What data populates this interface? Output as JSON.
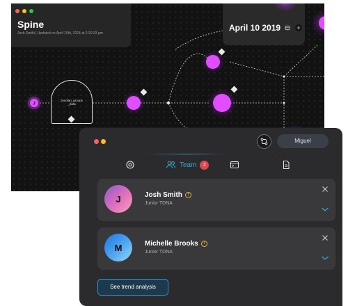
{
  "graph_window": {
    "title": "Spine",
    "subtitle": "Josh Smith | Updated on April 10th, 2024 at 2:20:33 pm",
    "date_label": "April 10 2019",
    "group_node_label": "zendian_groups\n_data"
  },
  "team_panel": {
    "user_name": "Miguel",
    "tabs": {
      "team_label": "Team",
      "team_count": "2"
    },
    "members": [
      {
        "initial": "J",
        "name": "Josh Smith",
        "role": "Junior TDNA"
      },
      {
        "initial": "M",
        "name": "Michelle Brooks",
        "role": "Junior TDNA"
      }
    ],
    "trend_button_label": "See trend analysis"
  },
  "colors": {
    "node_magenta": "#e04eff",
    "accent_blue": "#35a9d2",
    "badge_red": "#e0464e",
    "warning_yellow": "#e5b73b"
  },
  "icons": [
    "target-icon",
    "team-icon",
    "console-icon",
    "document-icon",
    "sync-icon",
    "calendar-icon",
    "plus-icon",
    "close-icon",
    "chevron-down-icon",
    "warning-icon"
  ]
}
